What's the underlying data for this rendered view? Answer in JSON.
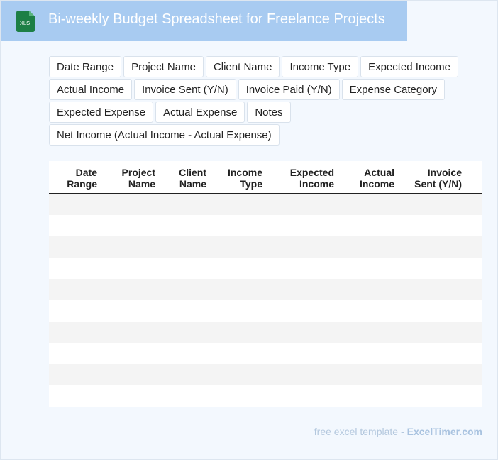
{
  "header": {
    "icon_label": "XLS",
    "title": "Bi-weekly Budget Spreadsheet for Freelance Projects"
  },
  "fields": [
    "Date Range",
    "Project Name",
    "Client Name",
    "Income Type",
    "Expected Income",
    "Actual Income",
    "Invoice Sent (Y/N)",
    "Invoice Paid (Y/N)",
    "Expense Category",
    "Expected Expense",
    "Actual Expense",
    "Notes",
    "Net Income (Actual Income - Actual Expense)"
  ],
  "table": {
    "columns": [
      [
        "Date",
        "Range"
      ],
      [
        "Project",
        "Name"
      ],
      [
        "Client",
        "Name"
      ],
      [
        "Income",
        "Type"
      ],
      [
        "Expected",
        "Income"
      ],
      [
        "Actual",
        "Income"
      ],
      [
        "Invoice",
        "Sent (Y/N)"
      ]
    ],
    "row_count": 10
  },
  "footer": {
    "text": "free excel template -",
    "brand": "ExcelTimer.com"
  },
  "colors": {
    "header_bg": "#a8cbf1",
    "page_bg": "#f3f8fe",
    "icon_green": "#1d7f45"
  }
}
